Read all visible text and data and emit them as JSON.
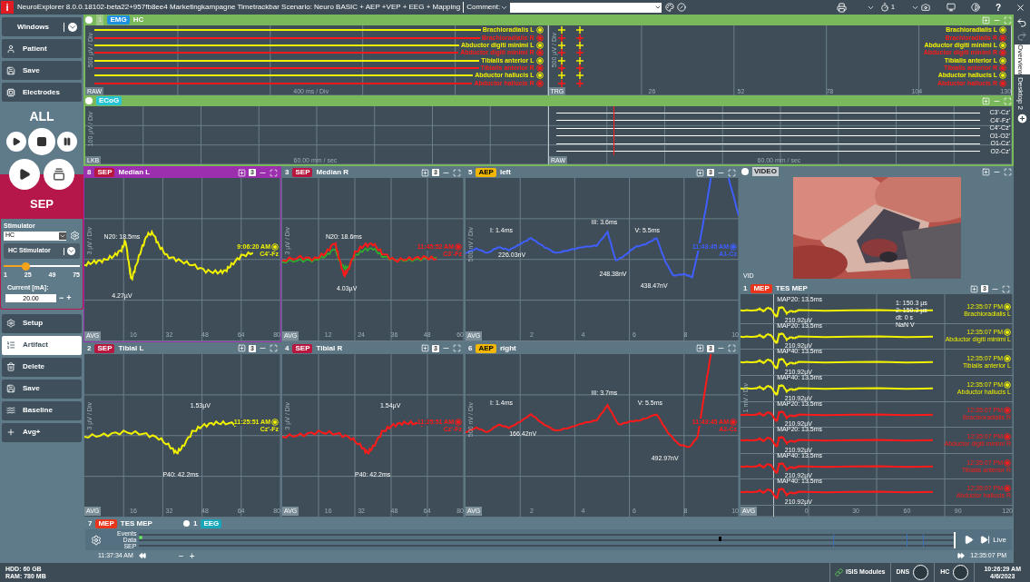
{
  "title_bar": {
    "logo": "i",
    "title": "NeuroExplorer 8.0.0.18102-beta22+957fb8ee4  Marketingkampagne Timetrackbar Scenario: Neuro BASIC + AEP +VEP + EEG + Mapping",
    "comment_label": "Comment:",
    "timer_count": "1",
    "help": "?"
  },
  "sidebar": {
    "top_buttons": [
      {
        "label": "Windows",
        "kind": "windows"
      },
      {
        "label": "Patient",
        "kind": "patient"
      },
      {
        "label": "Save",
        "kind": "save"
      },
      {
        "label": "Electrodes",
        "kind": "electrodes"
      }
    ],
    "all_label": "ALL",
    "mode": "SEP",
    "stimulator": {
      "label": "Stimulator",
      "value": "HC",
      "device": "HC Stimulator",
      "slider": {
        "level": 0.28
      },
      "ticks": [
        "1",
        "25",
        "49",
        "75"
      ],
      "current_label": "Current [mA]:",
      "current_value": "20.00",
      "minus": "−",
      "plus": "+"
    },
    "actions": [
      {
        "label": "Setup",
        "kind": "setup",
        "selected": false
      },
      {
        "label": "Artifact",
        "kind": "artifact",
        "selected": true
      },
      {
        "label": "Delete",
        "kind": "delete",
        "selected": false
      },
      {
        "label": "Save",
        "kind": "save",
        "selected": false
      },
      {
        "label": "Baseline",
        "kind": "baseline",
        "selected": false
      },
      {
        "label": "Avg+",
        "kind": "add",
        "selected": false
      }
    ],
    "storage": [
      "HDD: 60 GB",
      "RAM: 780 MB"
    ]
  },
  "emg": {
    "number": "1",
    "tag": {
      "label": "EMG",
      "color": "#1f8fe0"
    },
    "name": "HC",
    "left": {
      "mode": "RAW",
      "scale": "400 ms / Div",
      "yaxis": "500 µV / Div",
      "channels": [
        {
          "name": "Brachioradialis L",
          "color": "#f2f200"
        },
        {
          "name": "Brachioradialis R",
          "color": "#ff1a1a"
        },
        {
          "name": "Abductor digiti minimi L",
          "color": "#f2f200"
        },
        {
          "name": "Abductor digiti minimi R",
          "color": "#ff1a1a"
        },
        {
          "name": "Tibialis anterior L",
          "color": "#f2f200"
        },
        {
          "name": "Tibialis anterior R",
          "color": "#ff1a1a"
        },
        {
          "name": "Abductor hallucis L",
          "color": "#f2f200"
        },
        {
          "name": "Abductor hallucis R",
          "color": "#ff1a1a"
        }
      ]
    },
    "right": {
      "mode": "TRG",
      "yaxis": "500 µV / Div",
      "xticks": [
        "26",
        "52",
        "78",
        "104",
        "130"
      ],
      "channels": [
        {
          "name": "Brachioradialis L",
          "color": "#f2f200"
        },
        {
          "name": "Brachioradialis R",
          "color": "#ff1a1a"
        },
        {
          "name": "Abductor digiti minimi L",
          "color": "#f2f200"
        },
        {
          "name": "Abductor digiti minimi R",
          "color": "#ff1a1a"
        },
        {
          "name": "Tibialis anterior L",
          "color": "#f2f200"
        },
        {
          "name": "Tibialis anterior R",
          "color": "#ff1a1a"
        },
        {
          "name": "Abductor hallucis L",
          "color": "#f2f200"
        },
        {
          "name": "Abductor hallucis R",
          "color": "#ff1a1a"
        }
      ]
    }
  },
  "ecog": {
    "tag": {
      "label": "ECoG",
      "color": "#27c3d6"
    },
    "left": {
      "mode": "LKB",
      "scale": "60.00 mm / sec",
      "yaxis": "100 µV / Div"
    },
    "right": {
      "mode": "RAW",
      "scale": "60.00 mm / sec",
      "channels": [
        "C3'-Cz'",
        "C4'-Fz'",
        "C4'-Cz'",
        "O1-O2'",
        "O1-Cz'",
        "O2-Cz'"
      ]
    }
  },
  "panels": [
    {
      "number": "8",
      "tag": {
        "label": "SEP",
        "color": "#b8173f"
      },
      "title": "Median L",
      "count": "3",
      "selected": true,
      "kind": "sep",
      "yaxis": "3 µV / Div",
      "traces": [
        {
          "color": "#f2f200"
        }
      ],
      "annotations": [
        "N20: 18.5ms",
        "4.27µV"
      ],
      "time": "9:06:20 AM",
      "site": "C4'-Fz",
      "xticks": [
        "16",
        "32",
        "48",
        "64",
        "80"
      ],
      "avg": "AVG"
    },
    {
      "number": "3",
      "tag": {
        "label": "SEP",
        "color": "#b8173f"
      },
      "title": "Median R",
      "count": "3",
      "selected": false,
      "kind": "sep",
      "yaxis": "3 µV / Div",
      "traces": [
        {
          "color": "#ff1a1a"
        },
        {
          "color": "#2bb32b"
        }
      ],
      "annotations": [
        "N20: 18.6ms",
        "4.03µV"
      ],
      "time": "11:45:52 AM",
      "site": "C3'-Fz",
      "xticks": [
        "12",
        "24",
        "36",
        "48",
        "60"
      ],
      "avg": "AVG"
    },
    {
      "number": "5",
      "tag": {
        "label": "AEP",
        "color": "#f2b705"
      },
      "title": "left",
      "count": "3",
      "selected": false,
      "kind": "aep",
      "yaxis": "500 nV / Div",
      "traces": [
        {
          "color": "#3f5fff"
        }
      ],
      "annotations": [
        "I: 1.4ms",
        "226.03nV",
        "III: 3.6ms",
        "248.38nV",
        "V: 5.5ms",
        "438.47nV"
      ],
      "time": "11:43:45 AM",
      "site": "A1-Cz",
      "xticks": [
        "2",
        "4",
        "6",
        "8",
        "10"
      ],
      "avg": "AVG"
    },
    {
      "number": "2",
      "tag": {
        "label": "SEP",
        "color": "#b8173f"
      },
      "title": "Tibial L",
      "count": "3",
      "selected": false,
      "kind": "sep",
      "yaxis": "3 µV / Div",
      "traces": [
        {
          "color": "#f2f200"
        }
      ],
      "annotations": [
        "P40: 42.2ms",
        "1.53µV"
      ],
      "time": "11:25:51 AM",
      "site": "Cz'-Fz",
      "xticks": [
        "16",
        "32",
        "48",
        "64",
        "80"
      ],
      "avg": "AVG"
    },
    {
      "number": "4",
      "tag": {
        "label": "SEP",
        "color": "#b8173f"
      },
      "title": "Tibial R",
      "count": "3",
      "selected": false,
      "kind": "sep",
      "yaxis": "3 µV / Div",
      "traces": [
        {
          "color": "#ff1a1a"
        }
      ],
      "annotations": [
        "P40: 42.2ms",
        "1.54µV"
      ],
      "time": "11:25:51 AM",
      "site": "Cz'-Fz",
      "xticks": [
        "16",
        "32",
        "48",
        "64",
        "80"
      ],
      "avg": "AVG"
    },
    {
      "number": "6",
      "tag": {
        "label": "AEP",
        "color": "#f2b705"
      },
      "title": "right",
      "count": "3",
      "selected": false,
      "kind": "aep",
      "yaxis": "500 nV / Div",
      "traces": [
        {
          "color": "#ff1a1a"
        }
      ],
      "annotations": [
        "I: 1.4ms",
        "166.42nV",
        "III: 3.7ms",
        "V: 5.5ms",
        "492.97nV"
      ],
      "time": "11:43:45 AM",
      "site": "A2-Cz",
      "xticks": [
        "2",
        "4",
        "6",
        "8",
        "10"
      ],
      "avg": "AVG"
    }
  ],
  "video": {
    "tag": "VIDEO",
    "label": "VID",
    "kind": "picture"
  },
  "mep": {
    "number": "1",
    "tag": {
      "label": "MEP",
      "color": "#e8351c"
    },
    "title": "TES MEP",
    "count": "3",
    "yaxis": "1 mV / Div",
    "cursor": [
      "1: 150.3 µs",
      "2: 150.3 µs",
      "dt: 0 s",
      "NaN V"
    ],
    "xticks": [
      "0",
      "30",
      "60",
      "90",
      "120"
    ],
    "avg": "AVG",
    "traces": [
      {
        "marker": "MAP20: 13.5ms",
        "amplitude": "210.92µV",
        "time": "12:35:07 PM",
        "name": "Brachioradialis L",
        "color": "#f2f200"
      },
      {
        "marker": "MAP20: 13.5ms",
        "amplitude": "210.92µV",
        "time": "12:35:07 PM",
        "name": "Abductor digiti minimi L",
        "color": "#f2f200"
      },
      {
        "marker": "MAP40: 13.5ms",
        "amplitude": "210.92µV",
        "time": "12:35:07 PM",
        "name": "Tibialis anterior L",
        "color": "#f2f200"
      },
      {
        "marker": "MAP40: 13.5ms",
        "amplitude": "210.92µV",
        "time": "12:35:07 PM",
        "name": "Abductor hallucis L",
        "color": "#f2f200"
      },
      {
        "marker": "MAP20: 13.5ms",
        "amplitude": "210.92µV",
        "time": "12:35:07 PM",
        "name": "Brachioradialis R",
        "color": "#ff1a1a"
      },
      {
        "marker": "MAP20: 13.5ms",
        "amplitude": "210.92µV",
        "time": "12:35:07 PM",
        "name": "Abductor digiti minimi R",
        "color": "#ff1a1a"
      },
      {
        "marker": "MAP40: 13.5ms",
        "amplitude": "210.92µV",
        "time": "12:35:07 PM",
        "name": "Tibialis anterior R",
        "color": "#ff1a1a"
      },
      {
        "marker": "MAP40: 13.5ms",
        "amplitude": "210.92µV",
        "time": "12:35:07 PM",
        "name": "Abductor hallucis R",
        "color": "#ff1a1a"
      }
    ]
  },
  "bottom": {
    "windows": [
      {
        "number": "7",
        "tag": {
          "label": "MEP",
          "color": "#e8351c"
        },
        "name": "TES MEP"
      },
      {
        "number": "1",
        "tag": {
          "label": "EEG",
          "color": "#18a6b8"
        }
      }
    ],
    "timeline": {
      "tracks": [
        "Events",
        "Data",
        "SEP"
      ],
      "start": "11:37:34 AM",
      "end": "12:35:07 PM",
      "live": "Live",
      "minus": "−",
      "plus": "+"
    }
  },
  "status": {
    "modules": "ISIS Modules",
    "devices": [
      "DNS",
      "HC"
    ],
    "time": "10:26:29 AM",
    "date": "4/6/2023"
  },
  "side_tabs": [
    {
      "label": "Overview",
      "selected": true
    },
    {
      "label": "Desktop 2",
      "selected": false
    }
  ]
}
